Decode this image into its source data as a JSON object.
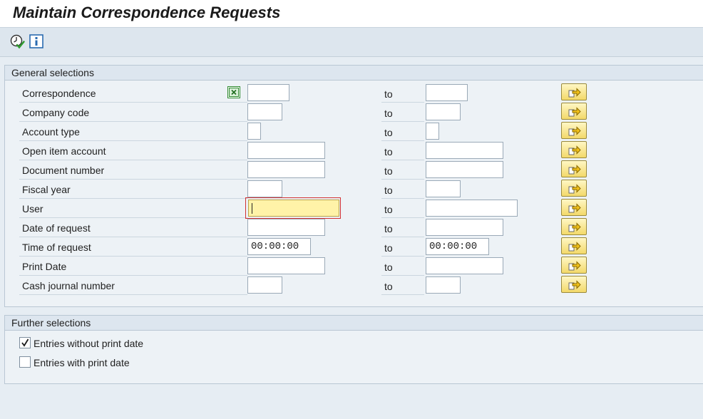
{
  "window": {
    "title": "Maintain Correspondence Requests"
  },
  "toolbar": {
    "buttons": [
      {
        "name": "execute",
        "icon": "execute-clock-icon"
      },
      {
        "name": "information",
        "icon": "info-icon"
      }
    ]
  },
  "general_selections": {
    "header": "General selections",
    "to_label": "to",
    "rows": [
      {
        "label": "Correspondence",
        "from_value": "",
        "to_value": ""
      },
      {
        "label": "Company code",
        "from_value": "",
        "to_value": ""
      },
      {
        "label": "Account type",
        "from_value": "",
        "to_value": ""
      },
      {
        "label": "Open item account",
        "from_value": "",
        "to_value": ""
      },
      {
        "label": "Document number",
        "from_value": "",
        "to_value": ""
      },
      {
        "label": "Fiscal year",
        "from_value": "",
        "to_value": ""
      },
      {
        "label": "User",
        "from_value": "",
        "to_value": ""
      },
      {
        "label": "Date of request",
        "from_value": "",
        "to_value": ""
      },
      {
        "label": "Time of request",
        "from_value": "00:00:00",
        "to_value": "00:00:00"
      },
      {
        "label": "Print Date",
        "from_value": "",
        "to_value": ""
      },
      {
        "label": "Cash journal number",
        "from_value": "",
        "to_value": ""
      }
    ]
  },
  "further_selections": {
    "header": "Further selections",
    "options": [
      {
        "label": "Entries without print date",
        "checked": true
      },
      {
        "label": "Entries with print date",
        "checked": false
      }
    ]
  },
  "colors": {
    "focus_field": "#fff3a8",
    "selection_button": "#f3d96a",
    "background": "#e6edf3"
  }
}
